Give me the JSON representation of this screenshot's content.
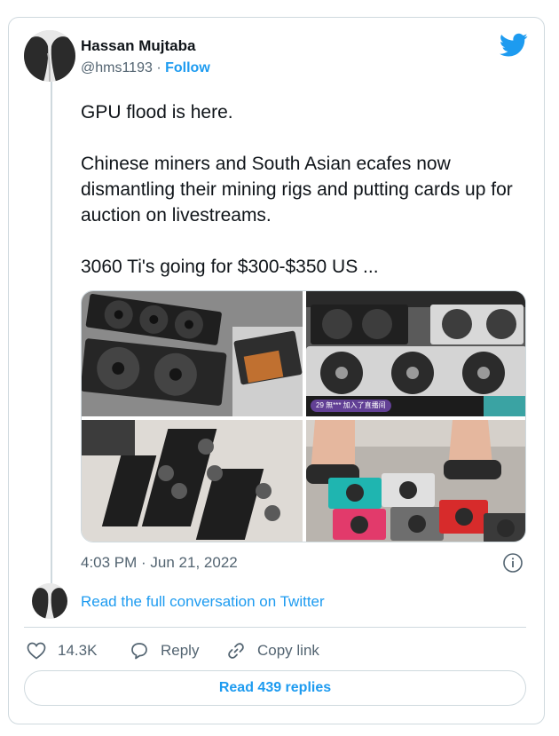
{
  "author": {
    "name": "Hassan Mujtaba",
    "handle": "@hms1193",
    "separator": "·",
    "follow_label": "Follow"
  },
  "tweet": {
    "paragraphs": [
      "GPU flood is here.",
      "Chinese miners and South Asian ecafes now dismantling their mining rigs and putting cards up for auction on livestreams.",
      "3060 Ti's going for $300-$350 US ..."
    ],
    "timestamp": "4:03 PM · Jun 21, 2022"
  },
  "media": {
    "livestream_overlay": "29 無*** 加入了直播间"
  },
  "conversation": {
    "link_label": "Read the full conversation on Twitter"
  },
  "actions": {
    "like_count": "14.3K",
    "reply_label": "Reply",
    "copy_label": "Copy link",
    "read_replies_label": "Read 439 replies"
  },
  "icons": {
    "brand": "twitter-bird-icon",
    "info": "info-icon",
    "like": "heart-icon",
    "reply": "speech-bubble-icon",
    "copy": "link-icon"
  },
  "colors": {
    "accent": "#1d9bf0",
    "text": "#0f1419",
    "secondary": "#536471",
    "border": "#cfd9de"
  }
}
